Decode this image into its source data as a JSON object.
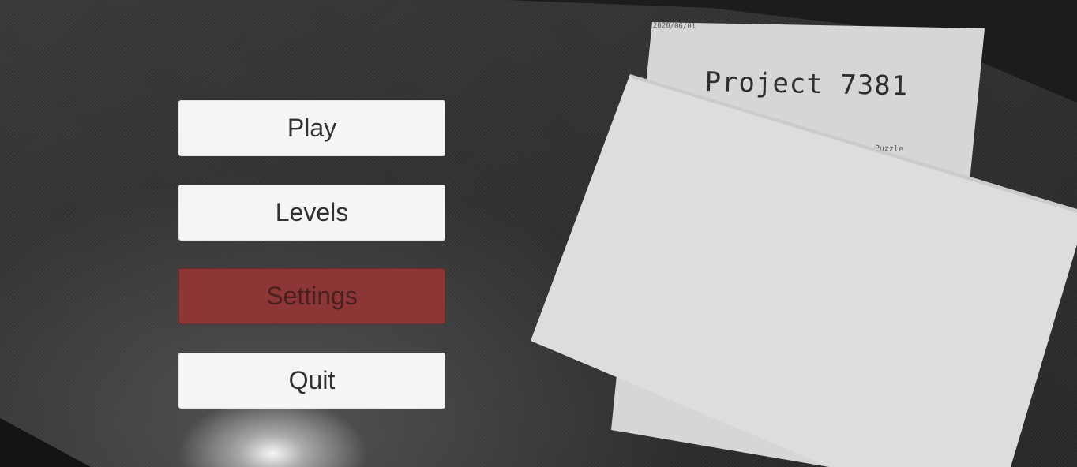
{
  "menu": {
    "play_label": "Play",
    "levels_label": "Levels",
    "settings_label": "Settings",
    "quit_label": "Quit",
    "selected_item": "Settings"
  },
  "paper": {
    "date": "2020/06/01",
    "title": "Project 7381",
    "genre_fragment": "Puzzle"
  },
  "colors": {
    "button_bg": "#f5f5f5",
    "button_text": "#323232",
    "selected_button_bg": "#8c3636",
    "paper": "#dddddd",
    "background": "#333333"
  }
}
